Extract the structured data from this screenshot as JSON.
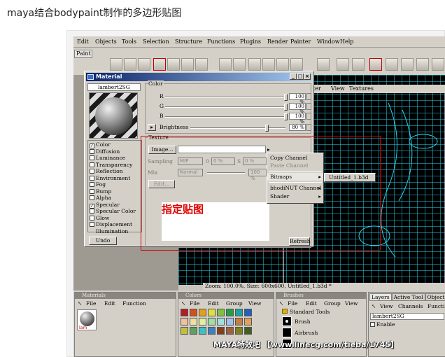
{
  "page_title": "maya结合bodypaint制作的多边形贴图",
  "menu": [
    "Edit",
    "Objects",
    "Tools",
    "Selection",
    "Structure",
    "Functions",
    "Plugins",
    "Render",
    "Painter",
    "Window",
    "Help"
  ],
  "palette_tab": "Paint",
  "viewport": {
    "menu": [
      "ter",
      "View",
      "Textures"
    ],
    "status": "Zoom: 100.0%, Size: 600x600, Untitled_1.b3d *"
  },
  "material_dialog": {
    "title": "Material",
    "material_name": "lambert2SG",
    "channels": [
      {
        "label": "Color",
        "checked": true
      },
      {
        "label": "Diffusion",
        "checked": false
      },
      {
        "label": "Luminance",
        "checked": false
      },
      {
        "label": "Transparency",
        "checked": false
      },
      {
        "label": "Reflection",
        "checked": false
      },
      {
        "label": "Environment",
        "checked": false
      },
      {
        "label": "Fog",
        "checked": false
      },
      {
        "label": "Bump",
        "checked": false
      },
      {
        "label": "Alpha",
        "checked": false
      },
      {
        "label": "Specular",
        "checked": true
      },
      {
        "label": "Specular Color",
        "checked": false
      },
      {
        "label": "Glow",
        "checked": false
      },
      {
        "label": "Displacement",
        "checked": false
      },
      {
        "label": "Illumination",
        "checked": null
      }
    ],
    "undo_label": "Undo",
    "color_group": {
      "label": "Color",
      "r_label": "R",
      "r_value": "100 %",
      "g_label": "G",
      "g_value": "100 %",
      "b_label": "B",
      "b_value": "100 %",
      "brightness_label": "Brightness",
      "brightness_value": "80 %",
      "brightness_level": 0.8
    },
    "texture_group": {
      "label": "Texture",
      "image_button": "Image...",
      "sampling_label": "Sampling",
      "sampling_value": "MIP",
      "sampling_num1": "0",
      "sampling_num2": "0 %",
      "s_label": "S",
      "s_value": "0 %",
      "mix_label": "Mix",
      "mix_value": "Normal",
      "mix_percent": "100 %",
      "edit_button": "Edit...",
      "refresh_button": "Refresh"
    }
  },
  "annotation": "指定贴图",
  "context_menu": {
    "items": [
      {
        "label": "Copy Channel",
        "enabled": true,
        "submenu": false
      },
      {
        "label": "Paste Channel",
        "enabled": false,
        "submenu": false
      },
      {
        "label": "Bitmaps",
        "enabled": true,
        "submenu": true
      },
      {
        "label": "bhodiNUT Channel",
        "enabled": true,
        "submenu": true
      },
      {
        "label": "Shader",
        "enabled": true,
        "submenu": true
      }
    ],
    "submenu_item": "Untitled_1.b3d"
  },
  "bottom_panels": {
    "materials": {
      "title": "Materials",
      "menu": [
        "File",
        "Edit",
        "Function"
      ],
      "thumb_label": "lam"
    },
    "colors": {
      "title": "Colors",
      "menu": [
        "File",
        "Edit",
        "Group",
        "View"
      ]
    },
    "brushes": {
      "title": "Brushes",
      "menu": [
        "File",
        "Edit",
        "Group",
        "View"
      ],
      "group": "Standard Tools",
      "items": [
        "Brush",
        "Airbrush",
        "Darken"
      ]
    },
    "layers": {
      "tabs": [
        "Layers",
        "Active Tool",
        "Object"
      ],
      "menu": [
        "View",
        "Channels",
        "Functi"
      ],
      "layer_name": "lambert2SG",
      "enable_label": "Enable"
    }
  },
  "watermark": "MAYA特效吧 【www.linecg.com/tieba/1745】",
  "colors": {
    "annotation_red": "#e00000",
    "frame_red": "#d40000",
    "mesh_cyan": "#27d3ea"
  }
}
